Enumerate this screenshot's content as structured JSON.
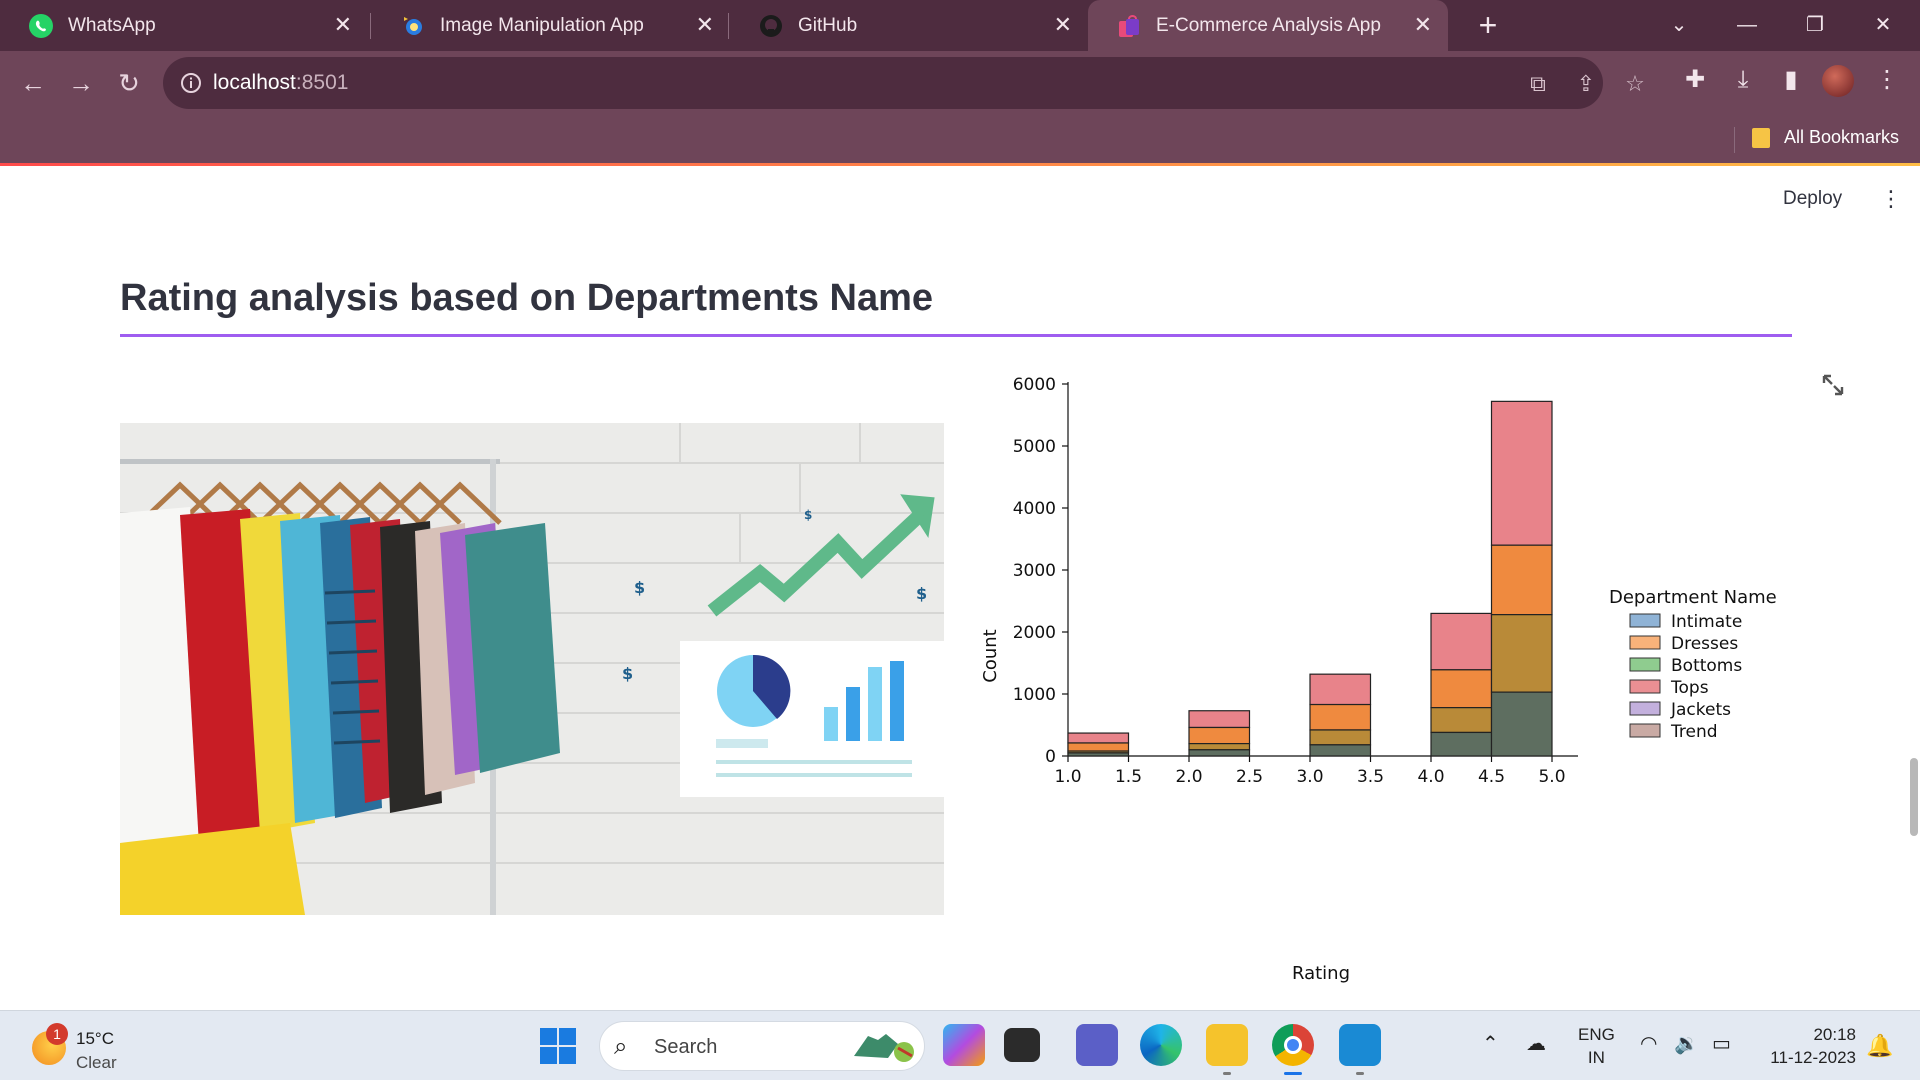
{
  "browser": {
    "tabs": [
      {
        "title": "WhatsApp",
        "icon": "whatsapp-icon",
        "active": false
      },
      {
        "title": "Image Manipulation App",
        "icon": "app-favicon-icon",
        "active": false
      },
      {
        "title": "GitHub",
        "icon": "github-icon",
        "active": false
      },
      {
        "title": "E-Commerce Analysis App",
        "icon": "shopping-bag-icon",
        "active": true
      }
    ],
    "url_host": "localhost",
    "url_port": ":8501",
    "bookmarks_label": "All Bookmarks",
    "colors": {
      "frame": "#4e2c3f",
      "toolbar": "#6e4559"
    }
  },
  "app": {
    "deploy_label": "Deploy",
    "title": "Rating analysis based on Departments Name",
    "accent_rule_color": "#9f5df0"
  },
  "chart_data": {
    "type": "bar",
    "stacked": true,
    "xlabel": "Rating",
    "ylabel": "Count",
    "xlim": [
      1.0,
      5.0
    ],
    "xticks": [
      "1.0",
      "1.5",
      "2.0",
      "2.5",
      "3.0",
      "3.5",
      "4.0",
      "4.5",
      "5.0"
    ],
    "ylim": [
      0,
      6000
    ],
    "yticks": [
      0,
      1000,
      2000,
      3000,
      4000,
      5000,
      6000
    ],
    "legend_title": "Department Name",
    "legend_position": "right",
    "bin_width": 0.5,
    "bins": [
      1.0,
      2.0,
      3.0,
      4.0,
      4.5
    ],
    "series": [
      {
        "name": "Intimate",
        "color": "#1f77b4",
        "values": [
          50,
          100,
          180,
          380,
          1030
        ]
      },
      {
        "name": "Dresses",
        "color": "#ff7f0e",
        "values": [
          210,
          460,
          830,
          1390,
          3400
        ]
      },
      {
        "name": "Bottoms",
        "color": "#2ca02c",
        "values": [
          50,
          100,
          180,
          380,
          1030
        ]
      },
      {
        "name": "Tops",
        "color": "#d62728",
        "values": [
          370,
          730,
          1320,
          2300,
          5720
        ]
      },
      {
        "name": "Jackets",
        "color": "#9467bd",
        "values": [
          20,
          50,
          80,
          120,
          300
        ]
      },
      {
        "name": "Trend",
        "color": "#8c564b",
        "values": [
          0,
          0,
          0,
          0,
          0
        ]
      }
    ],
    "segment_values": [
      {
        "bin": 1.0,
        "tops_top": 370,
        "dresses_top": 210,
        "bottoms_top": 80,
        "intimate_top": 50
      },
      {
        "bin": 2.0,
        "tops_top": 730,
        "dresses_top": 460,
        "bottoms_top": 200,
        "intimate_top": 100
      },
      {
        "bin": 3.0,
        "tops_top": 1320,
        "dresses_top": 830,
        "bottoms_top": 420,
        "intimate_top": 180
      },
      {
        "bin": 4.0,
        "tops_top": 2300,
        "dresses_top": 1390,
        "bottoms_top": 780,
        "intimate_top": 380
      },
      {
        "bin": 4.5,
        "tops_top": 5720,
        "dresses_top": 3400,
        "bottoms_top": 2280,
        "intimate_top": 1030
      }
    ]
  },
  "taskbar": {
    "weather_temp": "15°C",
    "weather_cond": "Clear",
    "weather_badge": "1",
    "search_label": "Search",
    "lang_line1": "ENG",
    "lang_line2": "IN",
    "time": "20:18",
    "date": "11-12-2023",
    "apps": [
      "copilot-icon",
      "terminal-icon",
      "teams-icon",
      "edge-icon",
      "file-explorer-icon",
      "chrome-icon",
      "vscode-icon"
    ]
  }
}
